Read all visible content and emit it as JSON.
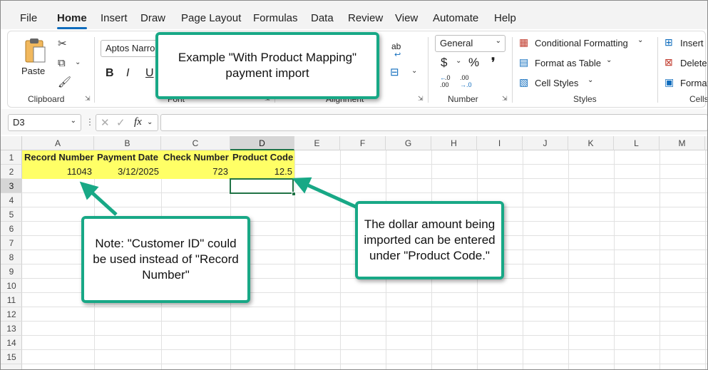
{
  "menu": {
    "tabs": [
      "File",
      "Home",
      "Insert",
      "Draw",
      "Page Layout",
      "Formulas",
      "Data",
      "Review",
      "View",
      "Automate",
      "Help"
    ],
    "active_tab": "Home"
  },
  "ribbon": {
    "clipboard": {
      "paste_label": "Paste",
      "group_label": "Clipboard"
    },
    "font": {
      "font_name": "Aptos Narro",
      "bold": "B",
      "italic": "I",
      "underline": "U",
      "group_label": "Font"
    },
    "alignment": {
      "group_label": "Alignment",
      "wrap_label": "ab"
    },
    "number": {
      "format": "General",
      "currency": "$",
      "percent": "%",
      "comma": "❜",
      "inc_decimal_top": ".0",
      "inc_decimal_bottom": ".00",
      "dec_decimal_top": ".00",
      "dec_decimal_bottom": "→.0",
      "group_label": "Number"
    },
    "styles": {
      "conditional": "Conditional Formatting",
      "format_table": "Format as Table",
      "cell_styles": "Cell Styles",
      "group_label": "Styles"
    },
    "cells": {
      "insert": "Insert",
      "delete": "Delete",
      "format": "Format",
      "group_label": "Cells"
    }
  },
  "formula_bar": {
    "name_box": "D3",
    "fx": "fx",
    "formula": ""
  },
  "columns": [
    "A",
    "B",
    "C",
    "D",
    "E",
    "F",
    "G",
    "H",
    "I",
    "J",
    "K",
    "L",
    "M"
  ],
  "rows": [
    "1",
    "2",
    "3",
    "4",
    "5",
    "6",
    "7",
    "8",
    "9",
    "10",
    "11",
    "12",
    "13",
    "14",
    "15"
  ],
  "sheet": {
    "header": [
      "Record Number",
      "Payment Date",
      "Check Number",
      "Product Code"
    ],
    "row2": [
      "11043",
      "3/12/2025",
      "723",
      "12.5"
    ],
    "highlight_color": "#ffff66",
    "selected_cell": "D3"
  },
  "callouts": {
    "top": "Example \"With Product Mapping\" payment import",
    "left": "Note: \"Customer ID\" could be used instead of \"Record Number\"",
    "right": "The dollar amount being imported can be entered under \"Product Code.\""
  },
  "colors": {
    "accent": "#18a886",
    "excel_green": "#217346",
    "tab_blue": "#0f6cbd"
  }
}
